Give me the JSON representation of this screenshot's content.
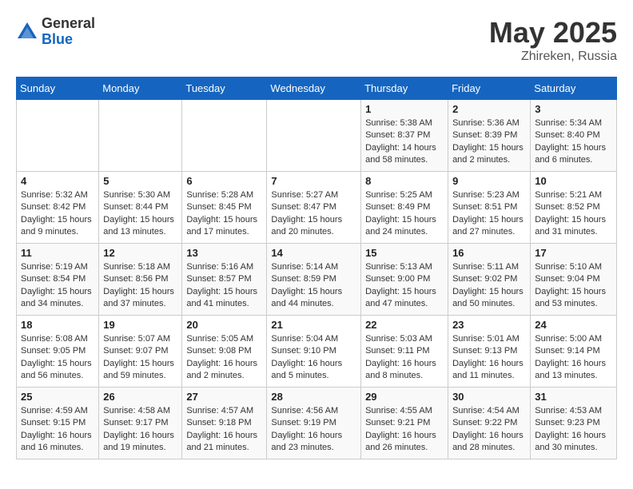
{
  "header": {
    "logo_general": "General",
    "logo_blue": "Blue",
    "title": "May 2025",
    "subtitle": "Zhireken, Russia"
  },
  "weekdays": [
    "Sunday",
    "Monday",
    "Tuesday",
    "Wednesday",
    "Thursday",
    "Friday",
    "Saturday"
  ],
  "weeks": [
    [
      {
        "day": "",
        "sunrise": "",
        "sunset": "",
        "daylight": "",
        "empty": true
      },
      {
        "day": "",
        "sunrise": "",
        "sunset": "",
        "daylight": "",
        "empty": true
      },
      {
        "day": "",
        "sunrise": "",
        "sunset": "",
        "daylight": "",
        "empty": true
      },
      {
        "day": "",
        "sunrise": "",
        "sunset": "",
        "daylight": "",
        "empty": true
      },
      {
        "day": "1",
        "sunrise": "Sunrise: 5:38 AM",
        "sunset": "Sunset: 8:37 PM",
        "daylight": "Daylight: 14 hours and 58 minutes."
      },
      {
        "day": "2",
        "sunrise": "Sunrise: 5:36 AM",
        "sunset": "Sunset: 8:39 PM",
        "daylight": "Daylight: 15 hours and 2 minutes."
      },
      {
        "day": "3",
        "sunrise": "Sunrise: 5:34 AM",
        "sunset": "Sunset: 8:40 PM",
        "daylight": "Daylight: 15 hours and 6 minutes."
      }
    ],
    [
      {
        "day": "4",
        "sunrise": "Sunrise: 5:32 AM",
        "sunset": "Sunset: 8:42 PM",
        "daylight": "Daylight: 15 hours and 9 minutes."
      },
      {
        "day": "5",
        "sunrise": "Sunrise: 5:30 AM",
        "sunset": "Sunset: 8:44 PM",
        "daylight": "Daylight: 15 hours and 13 minutes."
      },
      {
        "day": "6",
        "sunrise": "Sunrise: 5:28 AM",
        "sunset": "Sunset: 8:45 PM",
        "daylight": "Daylight: 15 hours and 17 minutes."
      },
      {
        "day": "7",
        "sunrise": "Sunrise: 5:27 AM",
        "sunset": "Sunset: 8:47 PM",
        "daylight": "Daylight: 15 hours and 20 minutes."
      },
      {
        "day": "8",
        "sunrise": "Sunrise: 5:25 AM",
        "sunset": "Sunset: 8:49 PM",
        "daylight": "Daylight: 15 hours and 24 minutes."
      },
      {
        "day": "9",
        "sunrise": "Sunrise: 5:23 AM",
        "sunset": "Sunset: 8:51 PM",
        "daylight": "Daylight: 15 hours and 27 minutes."
      },
      {
        "day": "10",
        "sunrise": "Sunrise: 5:21 AM",
        "sunset": "Sunset: 8:52 PM",
        "daylight": "Daylight: 15 hours and 31 minutes."
      }
    ],
    [
      {
        "day": "11",
        "sunrise": "Sunrise: 5:19 AM",
        "sunset": "Sunset: 8:54 PM",
        "daylight": "Daylight: 15 hours and 34 minutes."
      },
      {
        "day": "12",
        "sunrise": "Sunrise: 5:18 AM",
        "sunset": "Sunset: 8:56 PM",
        "daylight": "Daylight: 15 hours and 37 minutes."
      },
      {
        "day": "13",
        "sunrise": "Sunrise: 5:16 AM",
        "sunset": "Sunset: 8:57 PM",
        "daylight": "Daylight: 15 hours and 41 minutes."
      },
      {
        "day": "14",
        "sunrise": "Sunrise: 5:14 AM",
        "sunset": "Sunset: 8:59 PM",
        "daylight": "Daylight: 15 hours and 44 minutes."
      },
      {
        "day": "15",
        "sunrise": "Sunrise: 5:13 AM",
        "sunset": "Sunset: 9:00 PM",
        "daylight": "Daylight: 15 hours and 47 minutes."
      },
      {
        "day": "16",
        "sunrise": "Sunrise: 5:11 AM",
        "sunset": "Sunset: 9:02 PM",
        "daylight": "Daylight: 15 hours and 50 minutes."
      },
      {
        "day": "17",
        "sunrise": "Sunrise: 5:10 AM",
        "sunset": "Sunset: 9:04 PM",
        "daylight": "Daylight: 15 hours and 53 minutes."
      }
    ],
    [
      {
        "day": "18",
        "sunrise": "Sunrise: 5:08 AM",
        "sunset": "Sunset: 9:05 PM",
        "daylight": "Daylight: 15 hours and 56 minutes."
      },
      {
        "day": "19",
        "sunrise": "Sunrise: 5:07 AM",
        "sunset": "Sunset: 9:07 PM",
        "daylight": "Daylight: 15 hours and 59 minutes."
      },
      {
        "day": "20",
        "sunrise": "Sunrise: 5:05 AM",
        "sunset": "Sunset: 9:08 PM",
        "daylight": "Daylight: 16 hours and 2 minutes."
      },
      {
        "day": "21",
        "sunrise": "Sunrise: 5:04 AM",
        "sunset": "Sunset: 9:10 PM",
        "daylight": "Daylight: 16 hours and 5 minutes."
      },
      {
        "day": "22",
        "sunrise": "Sunrise: 5:03 AM",
        "sunset": "Sunset: 9:11 PM",
        "daylight": "Daylight: 16 hours and 8 minutes."
      },
      {
        "day": "23",
        "sunrise": "Sunrise: 5:01 AM",
        "sunset": "Sunset: 9:13 PM",
        "daylight": "Daylight: 16 hours and 11 minutes."
      },
      {
        "day": "24",
        "sunrise": "Sunrise: 5:00 AM",
        "sunset": "Sunset: 9:14 PM",
        "daylight": "Daylight: 16 hours and 13 minutes."
      }
    ],
    [
      {
        "day": "25",
        "sunrise": "Sunrise: 4:59 AM",
        "sunset": "Sunset: 9:15 PM",
        "daylight": "Daylight: 16 hours and 16 minutes."
      },
      {
        "day": "26",
        "sunrise": "Sunrise: 4:58 AM",
        "sunset": "Sunset: 9:17 PM",
        "daylight": "Daylight: 16 hours and 19 minutes."
      },
      {
        "day": "27",
        "sunrise": "Sunrise: 4:57 AM",
        "sunset": "Sunset: 9:18 PM",
        "daylight": "Daylight: 16 hours and 21 minutes."
      },
      {
        "day": "28",
        "sunrise": "Sunrise: 4:56 AM",
        "sunset": "Sunset: 9:19 PM",
        "daylight": "Daylight: 16 hours and 23 minutes."
      },
      {
        "day": "29",
        "sunrise": "Sunrise: 4:55 AM",
        "sunset": "Sunset: 9:21 PM",
        "daylight": "Daylight: 16 hours and 26 minutes."
      },
      {
        "day": "30",
        "sunrise": "Sunrise: 4:54 AM",
        "sunset": "Sunset: 9:22 PM",
        "daylight": "Daylight: 16 hours and 28 minutes."
      },
      {
        "day": "31",
        "sunrise": "Sunrise: 4:53 AM",
        "sunset": "Sunset: 9:23 PM",
        "daylight": "Daylight: 16 hours and 30 minutes."
      }
    ]
  ]
}
